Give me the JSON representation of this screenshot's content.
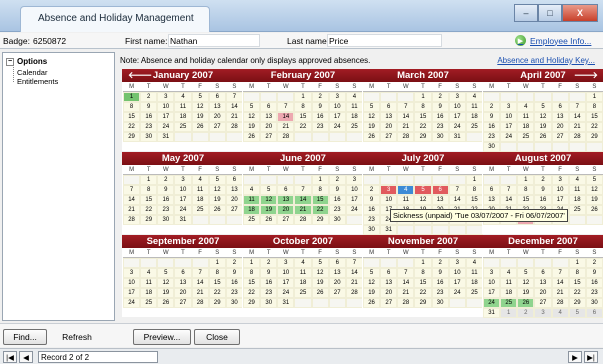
{
  "window": {
    "title": "Absence and Holiday Management",
    "min_glyph": "–",
    "max_glyph": "□",
    "close_glyph": "X"
  },
  "header": {
    "badge_label": "Badge:",
    "badge_value": "6250872",
    "firstname_label": "First name:",
    "firstname_value": "Nathan",
    "lastname_label": "Last name:",
    "lastname_value": "Price",
    "employee_info": "Employee Info...",
    "employee_info_icon": "arrow-right-circle-icon"
  },
  "tree": {
    "toggle": "−",
    "root": "Options",
    "items": [
      "Calendar",
      "Entitlements"
    ]
  },
  "note": "Note: Absence and holiday calendar only displays approved absences.",
  "key_link": "Absence and Holiday Key...",
  "weekday_headers": [
    "M",
    "T",
    "W",
    "T",
    "F",
    "S",
    "S"
  ],
  "prev_arrow": "🡐",
  "next_arrow": "🡒",
  "months": [
    {
      "name": "January 2007",
      "weeks": [
        [
          "1",
          "2",
          "3",
          "4",
          "5",
          "6",
          "7"
        ],
        [
          "8",
          "9",
          "10",
          "11",
          "12",
          "13",
          "14"
        ],
        [
          "15",
          "16",
          "17",
          "18",
          "19",
          "20",
          "21"
        ],
        [
          "22",
          "23",
          "24",
          "25",
          "26",
          "27",
          "28"
        ],
        [
          "29",
          "30",
          "31",
          "",
          "",
          "",
          ""
        ]
      ],
      "marks": {
        "1": "today"
      }
    },
    {
      "name": "February 2007",
      "weeks": [
        [
          "",
          "",
          "",
          "1",
          "2",
          "3",
          "4"
        ],
        [
          "5",
          "6",
          "7",
          "8",
          "9",
          "10",
          "11"
        ],
        [
          "12",
          "13",
          "14",
          "15",
          "16",
          "17",
          "18"
        ],
        [
          "19",
          "20",
          "21",
          "22",
          "23",
          "24",
          "25"
        ],
        [
          "26",
          "27",
          "28",
          "",
          "",
          "",
          ""
        ]
      ],
      "marks": {
        "14": "pink"
      }
    },
    {
      "name": "March 2007",
      "weeks": [
        [
          "",
          "",
          "",
          "1",
          "2",
          "3",
          "4"
        ],
        [
          "5",
          "6",
          "7",
          "8",
          "9",
          "10",
          "11"
        ],
        [
          "12",
          "13",
          "14",
          "15",
          "16",
          "17",
          "18"
        ],
        [
          "19",
          "20",
          "21",
          "22",
          "23",
          "24",
          "25"
        ],
        [
          "26",
          "27",
          "28",
          "29",
          "30",
          "31",
          ""
        ]
      ],
      "marks": {}
    },
    {
      "name": "April 2007",
      "weeks": [
        [
          "",
          "",
          "",
          "",
          "",
          "",
          "1"
        ],
        [
          "2",
          "3",
          "4",
          "5",
          "6",
          "7",
          "8"
        ],
        [
          "9",
          "10",
          "11",
          "12",
          "13",
          "14",
          "15"
        ],
        [
          "16",
          "17",
          "18",
          "19",
          "20",
          "21",
          "22"
        ],
        [
          "23",
          "24",
          "25",
          "26",
          "27",
          "28",
          "29"
        ],
        [
          "30",
          "",
          "",
          "",
          "",
          "",
          ""
        ]
      ],
      "marks": {}
    },
    {
      "name": "May 2007",
      "weeks": [
        [
          "",
          "1",
          "2",
          "3",
          "4",
          "5",
          "6"
        ],
        [
          "7",
          "8",
          "9",
          "10",
          "11",
          "12",
          "13"
        ],
        [
          "14",
          "15",
          "16",
          "17",
          "18",
          "19",
          "20"
        ],
        [
          "21",
          "22",
          "23",
          "24",
          "25",
          "26",
          "27"
        ],
        [
          "28",
          "29",
          "30",
          "31",
          "",
          "",
          ""
        ]
      ],
      "marks": {}
    },
    {
      "name": "June 2007",
      "weeks": [
        [
          "",
          "",
          "",
          "",
          "1",
          "2",
          "3"
        ],
        [
          "4",
          "5",
          "6",
          "7",
          "8",
          "9",
          "10"
        ],
        [
          "11",
          "12",
          "13",
          "14",
          "15",
          "16",
          "17"
        ],
        [
          "18",
          "19",
          "20",
          "21",
          "22",
          "23",
          "24"
        ],
        [
          "25",
          "26",
          "27",
          "28",
          "29",
          "30",
          ""
        ]
      ],
      "marks": {
        "11": "green",
        "12": "green",
        "13": "green",
        "14": "green",
        "15": "green",
        "18": "green",
        "19": "green",
        "20": "green",
        "21": "green",
        "22": "green"
      }
    },
    {
      "name": "July 2007",
      "weeks": [
        [
          "",
          "",
          "",
          "",
          "",
          "",
          "1"
        ],
        [
          "2",
          "3",
          "4",
          "5",
          "6",
          "7",
          "8"
        ],
        [
          "9",
          "10",
          "11",
          "12",
          "13",
          "14",
          "15"
        ],
        [
          "16",
          "17",
          "18",
          "19",
          "20",
          "21",
          "22"
        ],
        [
          "23",
          "24",
          "25",
          "26",
          "27",
          "28",
          "29"
        ],
        [
          "30",
          "31",
          "",
          "",
          "",
          "",
          ""
        ]
      ],
      "marks": {
        "3": "red",
        "4": "blue",
        "5": "red",
        "6": "red"
      }
    },
    {
      "name": "August 2007",
      "weeks": [
        [
          "",
          "",
          "1",
          "2",
          "3",
          "4",
          "5"
        ],
        [
          "6",
          "7",
          "8",
          "9",
          "10",
          "11",
          "12"
        ],
        [
          "13",
          "14",
          "15",
          "16",
          "17",
          "18",
          "19"
        ],
        [
          "20",
          "21",
          "22",
          "23",
          "24",
          "25",
          "26"
        ],
        [
          "27",
          "28",
          "29",
          "30",
          "31",
          "",
          ""
        ]
      ],
      "marks": {
        "29": "pink"
      }
    },
    {
      "name": "September 2007",
      "weeks": [
        [
          "",
          "",
          "",
          "",
          "",
          "1",
          "2"
        ],
        [
          "3",
          "4",
          "5",
          "6",
          "7",
          "8",
          "9"
        ],
        [
          "10",
          "11",
          "12",
          "13",
          "14",
          "15",
          "16"
        ],
        [
          "17",
          "18",
          "19",
          "20",
          "21",
          "22",
          "23"
        ],
        [
          "24",
          "25",
          "26",
          "27",
          "28",
          "29",
          "30"
        ]
      ],
      "marks": {}
    },
    {
      "name": "October 2007",
      "weeks": [
        [
          "1",
          "2",
          "3",
          "4",
          "5",
          "6",
          "7"
        ],
        [
          "8",
          "9",
          "10",
          "11",
          "12",
          "13",
          "14"
        ],
        [
          "15",
          "16",
          "17",
          "18",
          "19",
          "20",
          "21"
        ],
        [
          "22",
          "23",
          "24",
          "25",
          "26",
          "27",
          "28"
        ],
        [
          "29",
          "30",
          "31",
          "",
          "",
          "",
          ""
        ]
      ],
      "marks": {}
    },
    {
      "name": "November 2007",
      "weeks": [
        [
          "",
          "",
          "",
          "1",
          "2",
          "3",
          "4"
        ],
        [
          "5",
          "6",
          "7",
          "8",
          "9",
          "10",
          "11"
        ],
        [
          "12",
          "13",
          "14",
          "15",
          "16",
          "17",
          "18"
        ],
        [
          "19",
          "20",
          "21",
          "22",
          "23",
          "24",
          "25"
        ],
        [
          "26",
          "27",
          "28",
          "29",
          "30",
          "",
          ""
        ]
      ],
      "marks": {}
    },
    {
      "name": "December 2007",
      "weeks": [
        [
          "",
          "",
          "",
          "",
          "",
          "1",
          "2"
        ],
        [
          "3",
          "4",
          "5",
          "6",
          "7",
          "8",
          "9"
        ],
        [
          "10",
          "11",
          "12",
          "13",
          "14",
          "15",
          "16"
        ],
        [
          "17",
          "18",
          "19",
          "20",
          "21",
          "22",
          "23"
        ],
        [
          "24",
          "25",
          "26",
          "27",
          "28",
          "29",
          "30"
        ],
        [
          "31",
          "1",
          "2",
          "3",
          "4",
          "5",
          "6"
        ]
      ],
      "marks": {
        "24": "green",
        "25": "green",
        "26": "green"
      },
      "trailing_gray": true
    }
  ],
  "tooltip": "Sickness (unpaid) 'Tue 03/07/2007 - Fri 06/07/2007'",
  "buttons": {
    "find": "Find...",
    "refresh": "Refresh",
    "preview": "Preview...",
    "close": "Close"
  },
  "nav": {
    "first": "|◀",
    "prev": "◀",
    "record": "Record 2 of 2",
    "next": "▶",
    "last": "▶|"
  },
  "colors": {
    "month_header": "#8b141a",
    "approved": "#74c36f",
    "sickness": "#e15a5e",
    "selected": "#3d8bd6"
  }
}
